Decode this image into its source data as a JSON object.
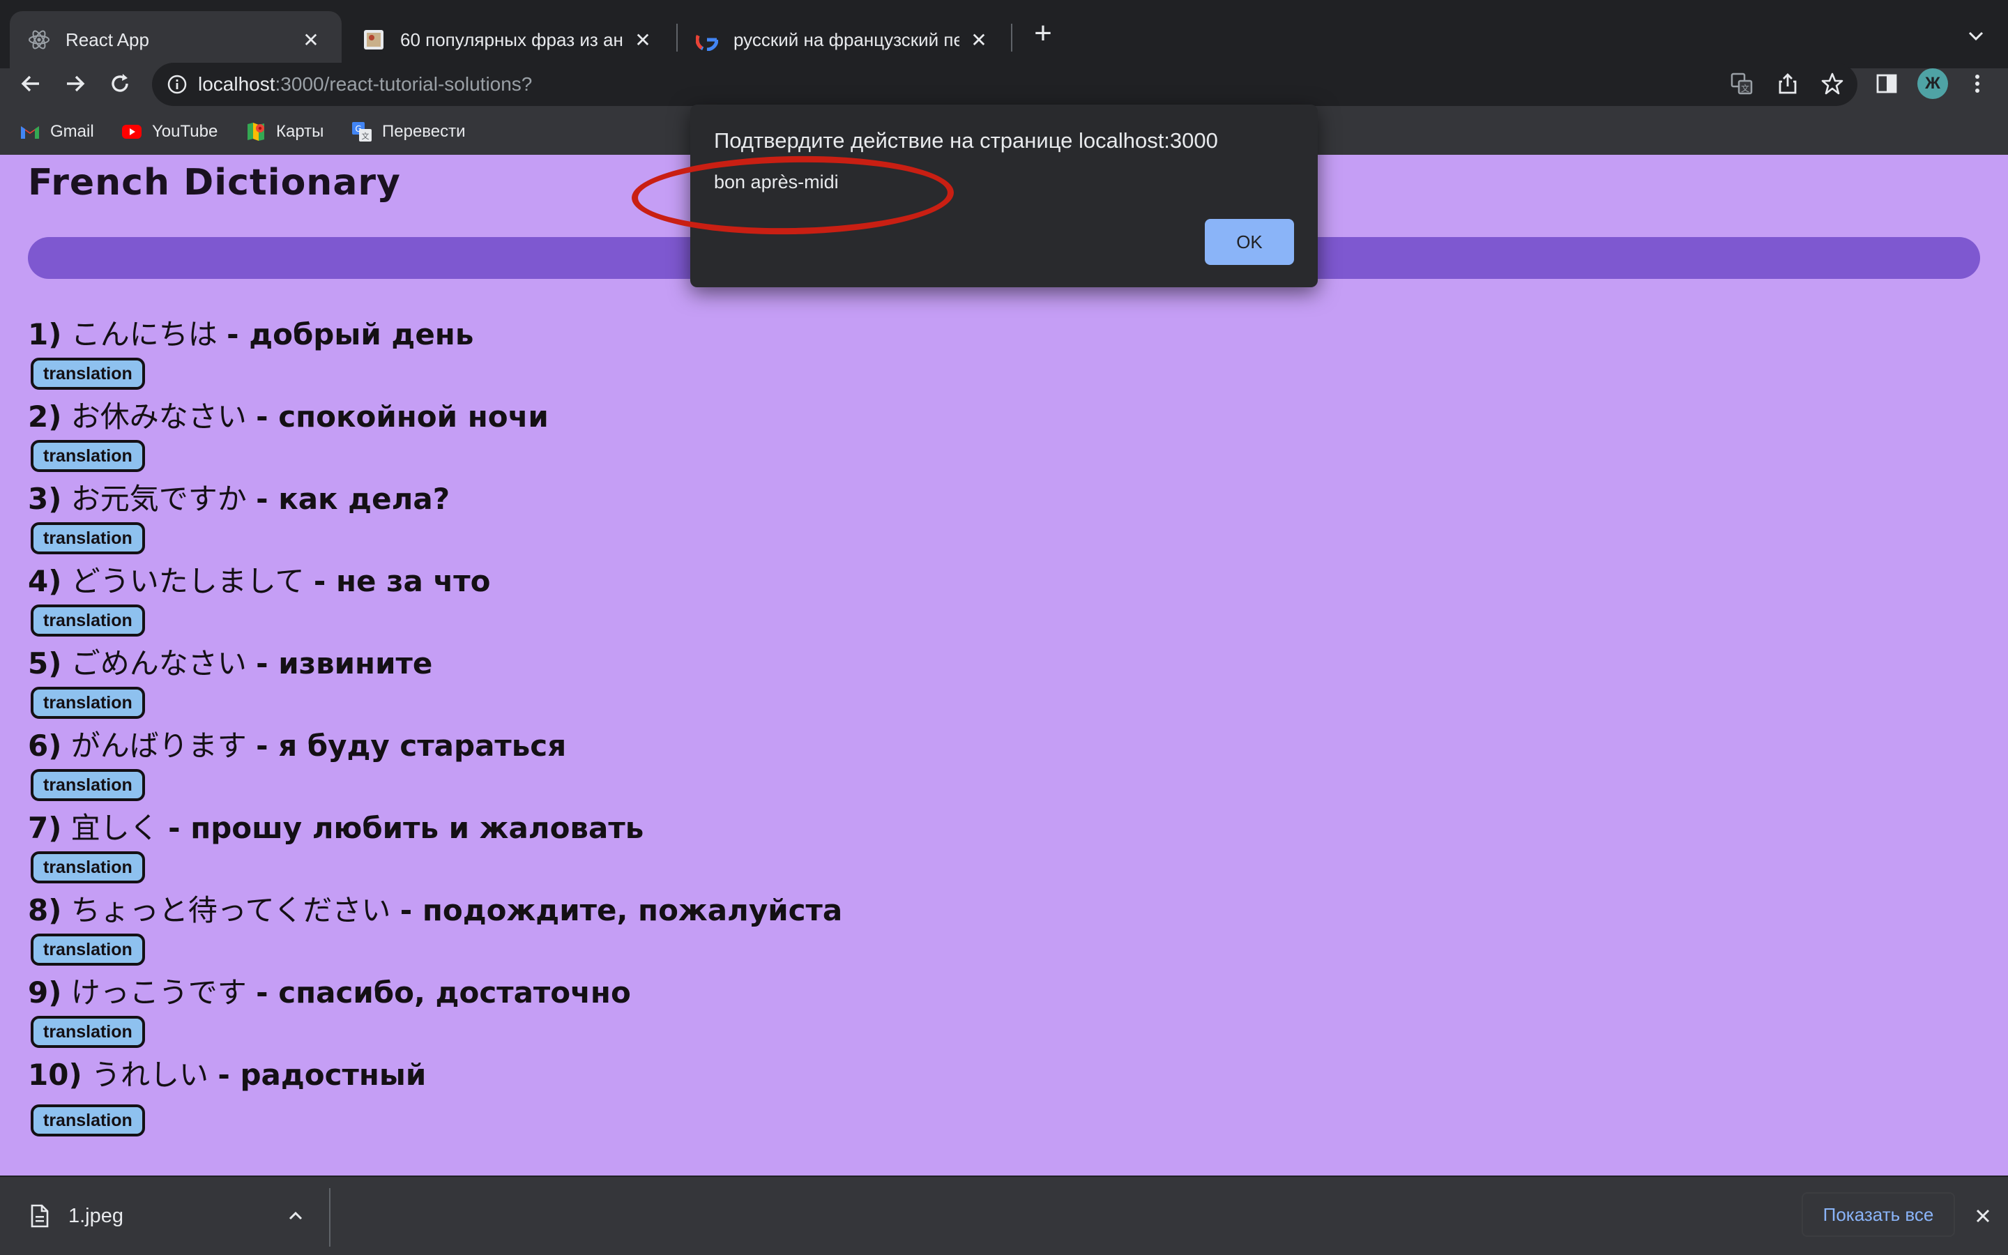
{
  "browser": {
    "tabs": [
      {
        "title": "React App",
        "active": true,
        "icon": "react-icon"
      },
      {
        "title": "60 популярных фраз из аниме",
        "active": false,
        "icon": "image-icon"
      },
      {
        "title": "русский на французский пере",
        "active": false,
        "icon": "google-icon"
      }
    ],
    "url_host": "localhost",
    "url_rest": ":3000/react-tutorial-solutions?",
    "avatar_letter": "Ж",
    "bookmarks": [
      {
        "label": "Gmail",
        "icon": "gmail-icon"
      },
      {
        "label": "YouTube",
        "icon": "youtube-icon"
      },
      {
        "label": "Карты",
        "icon": "maps-icon"
      },
      {
        "label": "Перевести",
        "icon": "translate-icon"
      }
    ]
  },
  "page": {
    "title": "French Dictionary",
    "button_label": "translation",
    "entries": [
      {
        "num": "1)",
        "jp": "こんにちは",
        "ru": "- добрый день"
      },
      {
        "num": "2)",
        "jp": "お休みなさい",
        "ru": "- спокойной ночи"
      },
      {
        "num": "3)",
        "jp": "お元気ですか",
        "ru": "- как дела?"
      },
      {
        "num": "4)",
        "jp": "どういたしまして",
        "ru": "- не за что"
      },
      {
        "num": "5)",
        "jp": "ごめんなさい",
        "ru": "- извините"
      },
      {
        "num": "6)",
        "jp": "がんばります",
        "ru": "- я буду стараться"
      },
      {
        "num": "7)",
        "jp": "宜しく",
        "ru": "- прошу любить и жаловать"
      },
      {
        "num": "8)",
        "jp": "ちょっと待ってください",
        "ru": "- подождите, пожалуйста"
      },
      {
        "num": "9)",
        "jp": "けっこうです",
        "ru": "- спасибо, достаточно"
      },
      {
        "num": "10)",
        "jp": "うれしい",
        "ru": "- радостный"
      }
    ]
  },
  "dialog": {
    "title": "Подтвердите действие на странице localhost:3000",
    "message": "bon après-midi",
    "ok_label": "OK"
  },
  "downloads": {
    "file_name": "1.jpeg",
    "show_all_label": "Показать все"
  },
  "colors": {
    "page_bg": "#c59ef5",
    "bar": "#7e58d0",
    "button_bg": "#8ec1ef",
    "annotation": "#c91f13"
  }
}
